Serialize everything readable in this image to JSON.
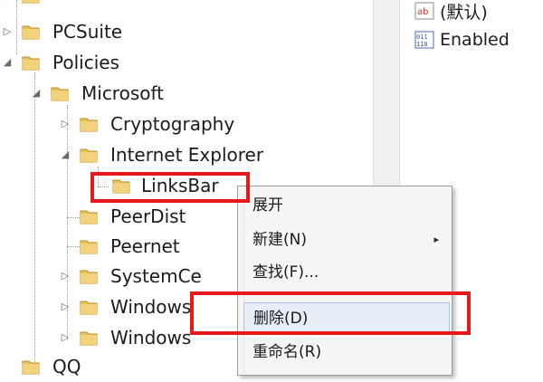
{
  "tree": {
    "items": [
      {
        "label": "PCSuite"
      },
      {
        "label": "Policies"
      },
      {
        "label": "Microsoft"
      },
      {
        "label": "Cryptography"
      },
      {
        "label": "Internet Explorer"
      },
      {
        "label": "LinksBar"
      },
      {
        "label": "PeerDist"
      },
      {
        "label": "Peernet"
      },
      {
        "label": "SystemCe"
      },
      {
        "label": "Windows"
      },
      {
        "label": "Windows"
      },
      {
        "label": "QQ"
      }
    ]
  },
  "right_pane": {
    "items": [
      {
        "label": "(默认)",
        "icon": "string-value-icon"
      },
      {
        "label": "Enabled",
        "icon": "binary-value-icon"
      }
    ]
  },
  "context_menu": {
    "items": [
      {
        "label": "展开"
      },
      {
        "label": "新建(N)",
        "submenu_arrow": "▸"
      },
      {
        "label": "查找(F)..."
      },
      {
        "label": "删除(D)"
      },
      {
        "label": "重命名(R)"
      }
    ]
  },
  "colors": {
    "highlight_box": "#e8191b",
    "folder": "#e9c15a",
    "menu_hover": "#e6eef8"
  }
}
